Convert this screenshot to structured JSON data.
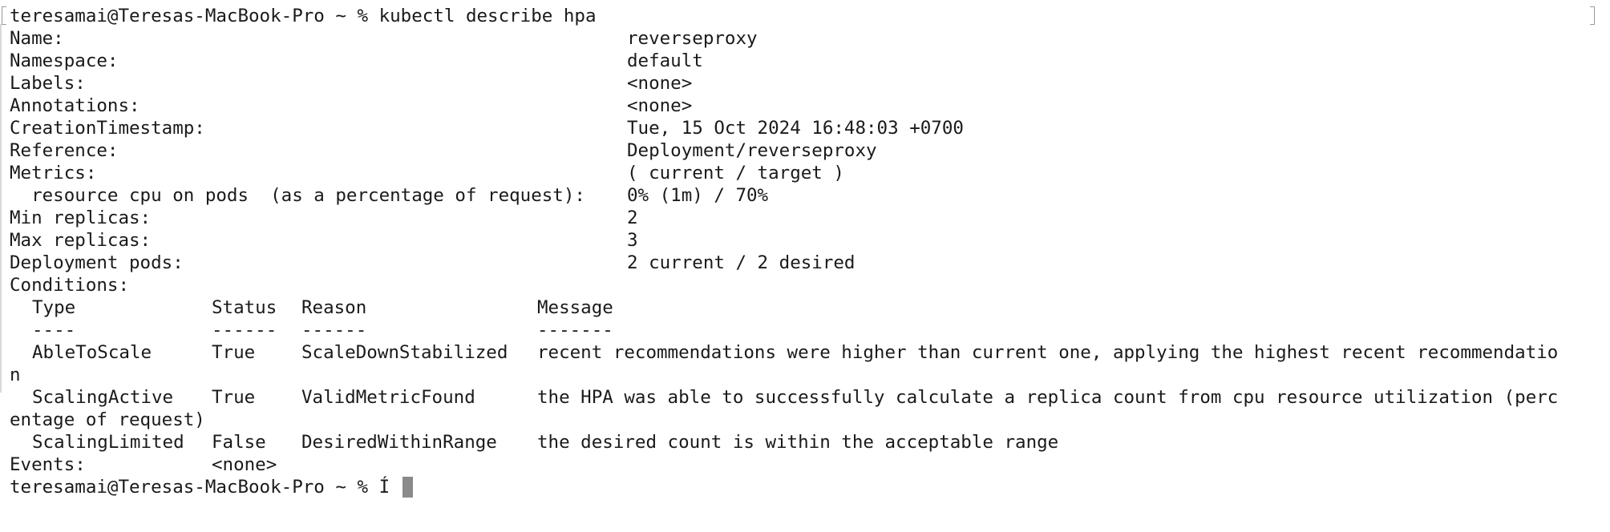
{
  "terminal": {
    "command_line": "teresamai@Teresas-MacBook-Pro ~ % kubectl describe hpa",
    "prompt": "teresamai@Teresas-MacBook-Pro ~ % ",
    "typed_input": "Í",
    "fields": [
      {
        "label": "Name:",
        "value": "reverseproxy"
      },
      {
        "label": "Namespace:",
        "value": "default"
      },
      {
        "label": "Labels:",
        "value": "<none>"
      },
      {
        "label": "Annotations:",
        "value": "<none>"
      },
      {
        "label": "CreationTimestamp:",
        "value": "Tue, 15 Oct 2024 16:48:03 +0700"
      },
      {
        "label": "Reference:",
        "value": "Deployment/reverseproxy"
      },
      {
        "label": "Metrics:",
        "value": "( current / target )"
      },
      {
        "label": "  resource cpu on pods  (as a percentage of request):",
        "value": "0% (1m) / 70%"
      },
      {
        "label": "Min replicas:",
        "value": "2"
      },
      {
        "label": "Max replicas:",
        "value": "3"
      },
      {
        "label": "Deployment pods:",
        "value": "2 current / 2 desired"
      }
    ],
    "conditions_label": "Conditions:",
    "conditions_header": {
      "type": "Type",
      "status": "Status",
      "reason": "Reason",
      "message": "Message"
    },
    "conditions_underline": {
      "type": "----",
      "status": "------",
      "reason": "------",
      "message": "-------"
    },
    "conditions": [
      {
        "type": "AbleToScale",
        "status": "True",
        "reason": "ScaleDownStabilized",
        "message": "recent recommendations were higher than current one, applying the highest recent recommendatio",
        "wrap": "n"
      },
      {
        "type": "ScalingActive",
        "status": "True",
        "reason": "ValidMetricFound",
        "message": "the HPA was able to successfully calculate a replica count from cpu resource utilization (perc",
        "wrap": "entage of request)"
      },
      {
        "type": "ScalingLimited",
        "status": "False",
        "reason": "DesiredWithinRange",
        "message": "the desired count is within the acceptable range",
        "wrap": ""
      }
    ],
    "events": {
      "label": "Events:",
      "value": "<none>"
    }
  }
}
